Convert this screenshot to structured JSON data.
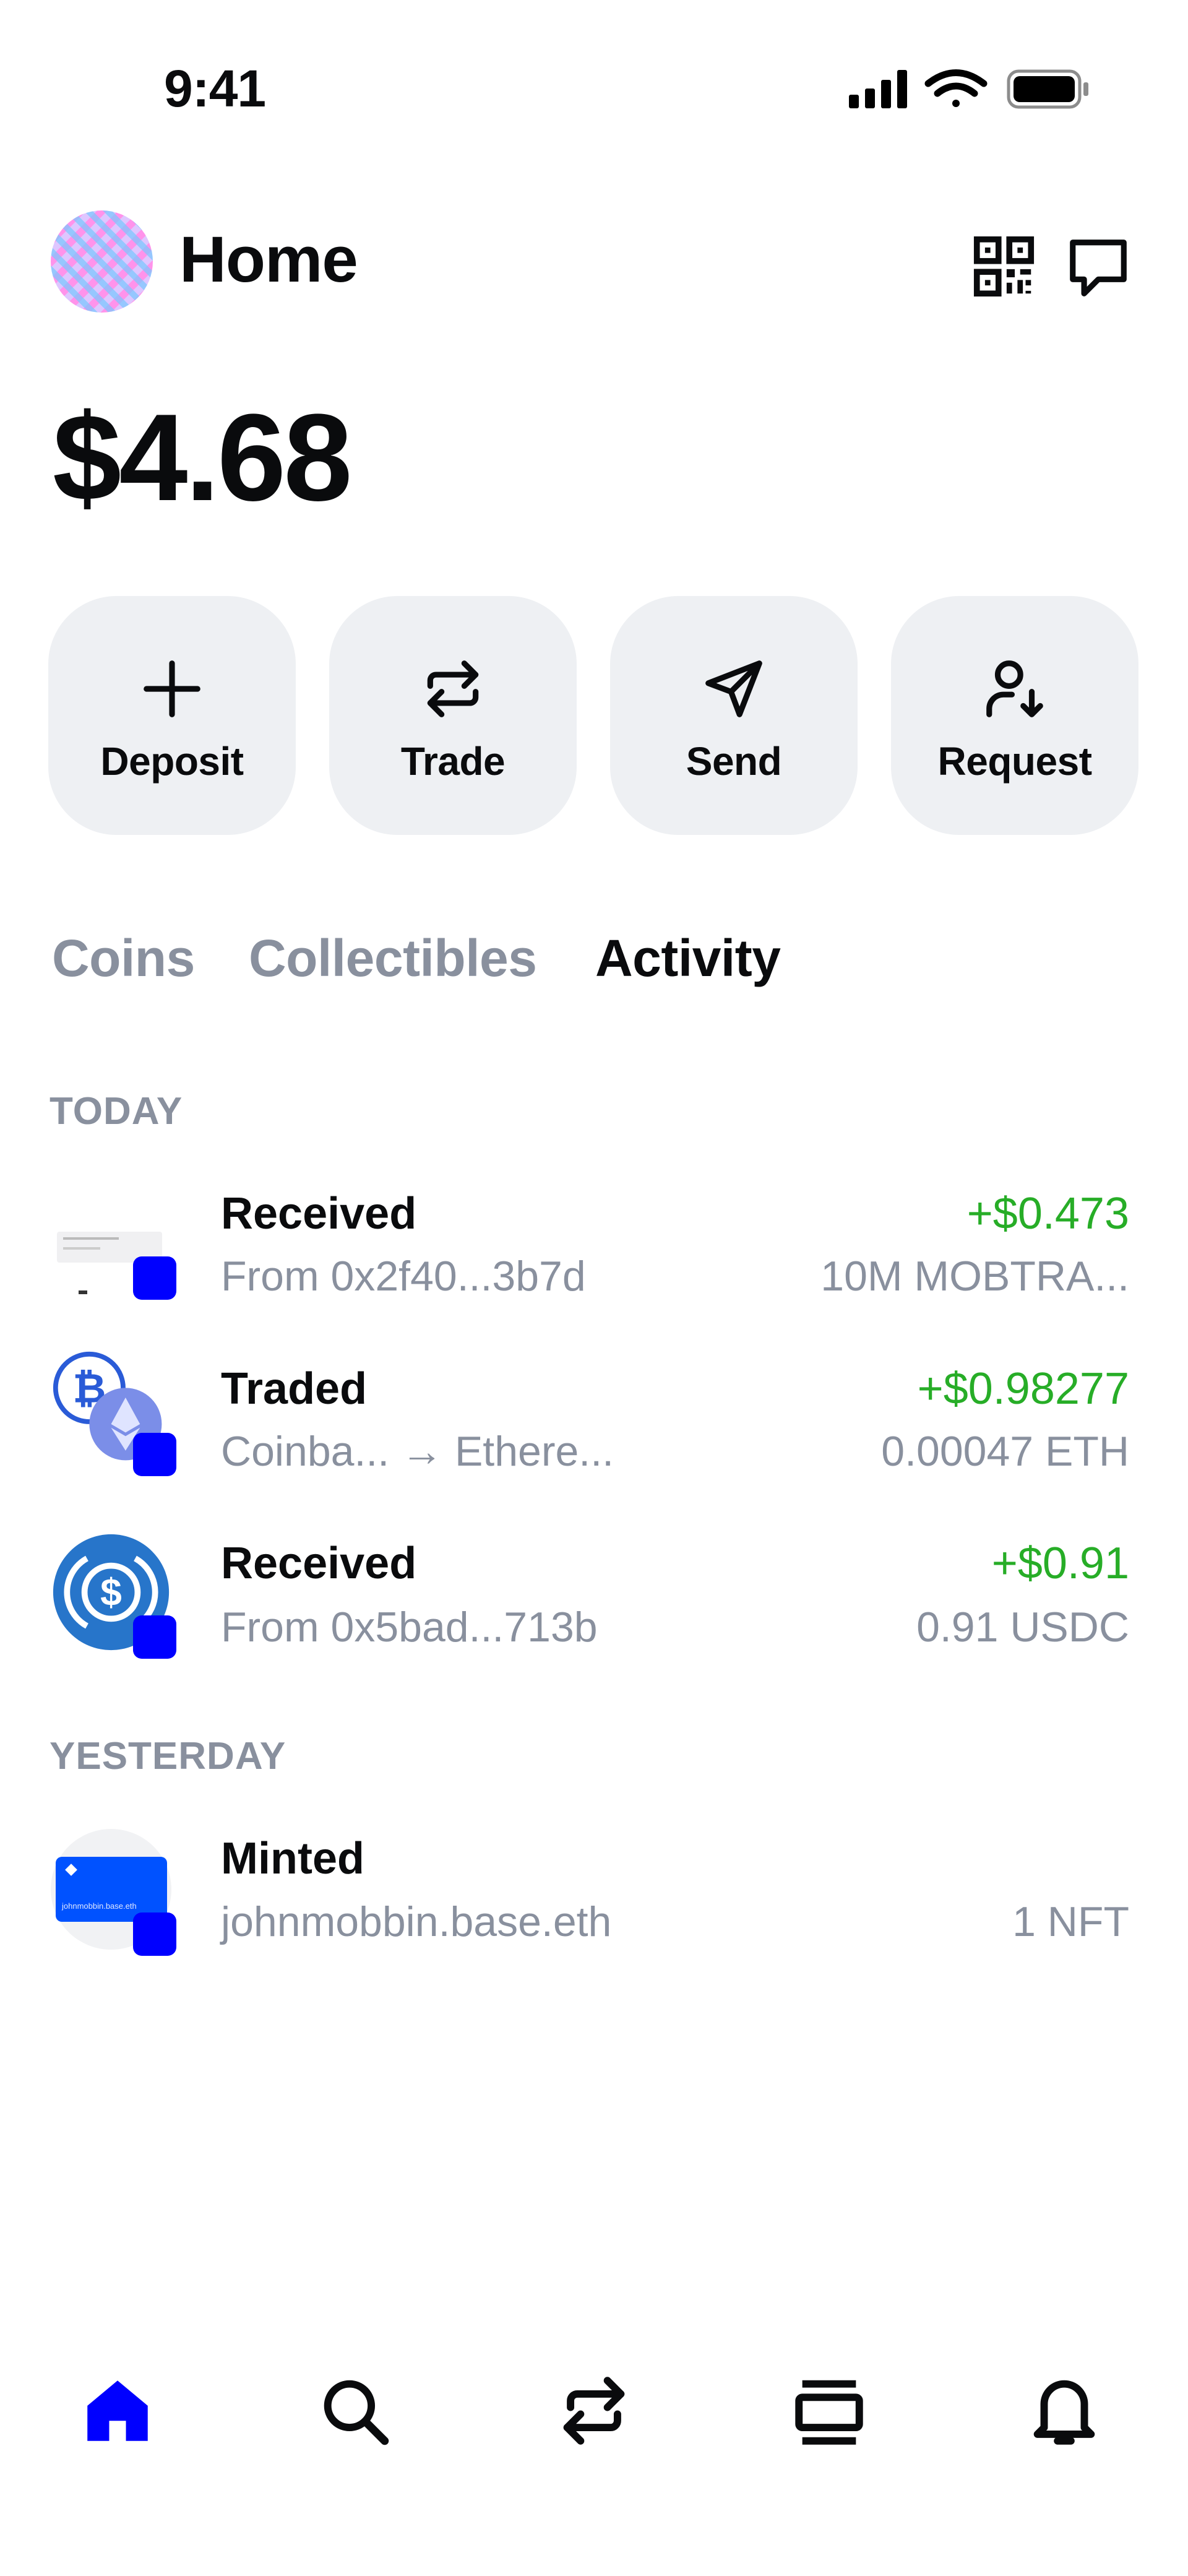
{
  "status_bar": {
    "time": "9:41"
  },
  "header": {
    "title": "Home",
    "qr_icon": "qr-code-icon",
    "chat_icon": "chat-icon"
  },
  "balance": "$4.68",
  "actions": [
    {
      "label": "Deposit",
      "icon": "plus-icon"
    },
    {
      "label": "Trade",
      "icon": "swap-icon"
    },
    {
      "label": "Send",
      "icon": "send-icon"
    },
    {
      "label": "Request",
      "icon": "user-request-icon"
    }
  ],
  "tabs": [
    {
      "label": "Coins",
      "active": false
    },
    {
      "label": "Collectibles",
      "active": false
    },
    {
      "label": "Activity",
      "active": true
    }
  ],
  "sections": [
    {
      "label": "TODAY",
      "items": [
        {
          "title": "Received",
          "subtitle": "From 0x2f40...3b7d",
          "amount": "+$0.473",
          "quantity": "10M MOBTRA..."
        },
        {
          "title": "Traded",
          "subtitle": "Coinba... → Ethere...",
          "amount": "+$0.98277",
          "quantity": "0.00047 ETH"
        },
        {
          "title": "Received",
          "subtitle": "From 0x5bad...713b",
          "amount": "+$0.91",
          "quantity": "0.91 USDC"
        }
      ]
    },
    {
      "label": "YESTERDAY",
      "items": [
        {
          "title": "Minted",
          "subtitle": "johnmobbin.base.eth",
          "amount": "",
          "quantity": "1 NFT",
          "card_text": "johnmobbin.base.eth"
        }
      ]
    }
  ],
  "bottom_nav": [
    {
      "icon": "home-icon",
      "active": true
    },
    {
      "icon": "search-icon",
      "active": false
    },
    {
      "icon": "swap-icon",
      "active": false
    },
    {
      "icon": "browser-icon",
      "active": false
    },
    {
      "icon": "bell-icon",
      "active": false
    }
  ],
  "colors": {
    "accent": "#0000ff",
    "positive": "#27ad27",
    "muted": "#89909e",
    "button_bg": "#eef0f3"
  }
}
